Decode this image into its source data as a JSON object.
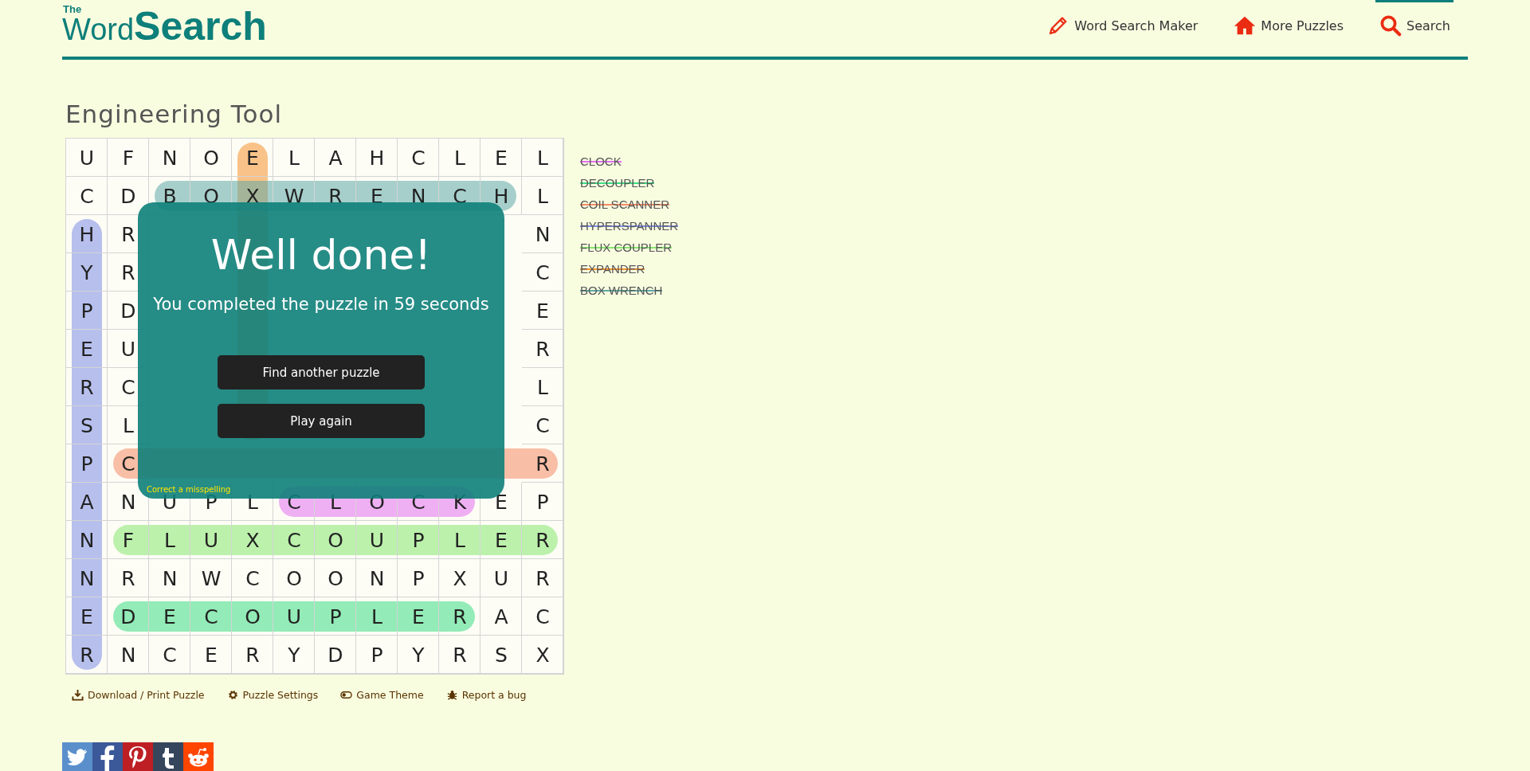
{
  "logo": {
    "small": "The",
    "light": "Word",
    "bold": "Search"
  },
  "nav": [
    {
      "label": "Word Search Maker",
      "kind": "pencil",
      "selected": false
    },
    {
      "label": "More Puzzles",
      "kind": "house",
      "selected": false
    },
    {
      "label": "Search",
      "kind": "search",
      "selected": true
    }
  ],
  "title": "Engineering Tool",
  "grid": {
    "rows": [
      [
        "U",
        "F",
        "N",
        "O",
        "E",
        "L",
        "A",
        "H",
        "C",
        "L",
        "E",
        "L"
      ],
      [
        "C",
        "D",
        "B",
        "O",
        "X",
        "W",
        "R",
        "E",
        "N",
        "C",
        "H",
        "L"
      ],
      [
        "H",
        "R",
        null,
        null,
        null,
        null,
        null,
        null,
        null,
        null,
        null,
        "N"
      ],
      [
        "Y",
        "R",
        null,
        null,
        null,
        null,
        null,
        null,
        null,
        null,
        null,
        "C"
      ],
      [
        "P",
        "D",
        null,
        null,
        null,
        null,
        null,
        null,
        null,
        null,
        null,
        "E"
      ],
      [
        "E",
        "U",
        null,
        null,
        null,
        null,
        null,
        null,
        null,
        null,
        null,
        "R"
      ],
      [
        "R",
        "C",
        null,
        null,
        null,
        null,
        null,
        null,
        null,
        null,
        null,
        "L"
      ],
      [
        "S",
        "L",
        null,
        null,
        null,
        null,
        null,
        null,
        null,
        null,
        null,
        "C"
      ],
      [
        "P",
        "C",
        null,
        null,
        null,
        null,
        null,
        null,
        null,
        null,
        null,
        "R"
      ],
      [
        "A",
        "N",
        "U",
        "P",
        "L",
        "C",
        "L",
        "O",
        "C",
        "K",
        "E",
        "P"
      ],
      [
        "N",
        "F",
        "L",
        "U",
        "X",
        "C",
        "O",
        "U",
        "P",
        "L",
        "E",
        "R"
      ],
      [
        "N",
        "R",
        "N",
        "W",
        "C",
        "O",
        "O",
        "N",
        "P",
        "X",
        "U",
        "R"
      ],
      [
        "E",
        "D",
        "E",
        "C",
        "O",
        "U",
        "P",
        "L",
        "E",
        "R",
        "A",
        "C"
      ],
      [
        "R",
        "N",
        "C",
        "E",
        "R",
        "Y",
        "D",
        "P",
        "Y",
        "R",
        "S",
        "X"
      ]
    ]
  },
  "words": [
    {
      "label": "CLOCK",
      "found": true,
      "color": "#e36ff0"
    },
    {
      "label": "DECOUPLER",
      "found": true,
      "color": "#3ddc84"
    },
    {
      "label": "COIL SCANNER",
      "found": true,
      "color": "#f58a64"
    },
    {
      "label": "HYPERSPANNER",
      "found": true,
      "color": "#7d8ce6"
    },
    {
      "label": "FLUX COUPLER",
      "found": true,
      "color": "#86e870"
    },
    {
      "label": "EXPANDER",
      "found": true,
      "color": "#f5922e"
    },
    {
      "label": "BOX WRENCH",
      "found": true,
      "color": "#5eaaa8"
    }
  ],
  "dialog": {
    "title": "Well done!",
    "message": "You completed the puzzle in 59 seconds",
    "buttons": [
      "Find another puzzle",
      "Play again"
    ],
    "link": "Correct a misspelling"
  },
  "tools": [
    {
      "label": "Download / Print Puzzle",
      "kind": "download"
    },
    {
      "label": "Puzzle Settings",
      "kind": "gear"
    },
    {
      "label": "Game Theme",
      "kind": "toggle"
    },
    {
      "label": "Report a bug",
      "kind": "bug"
    }
  ],
  "share": [
    {
      "kind": "twitter"
    },
    {
      "kind": "facebook"
    },
    {
      "kind": "pinterest"
    },
    {
      "kind": "tumblr"
    },
    {
      "kind": "reddit"
    }
  ]
}
